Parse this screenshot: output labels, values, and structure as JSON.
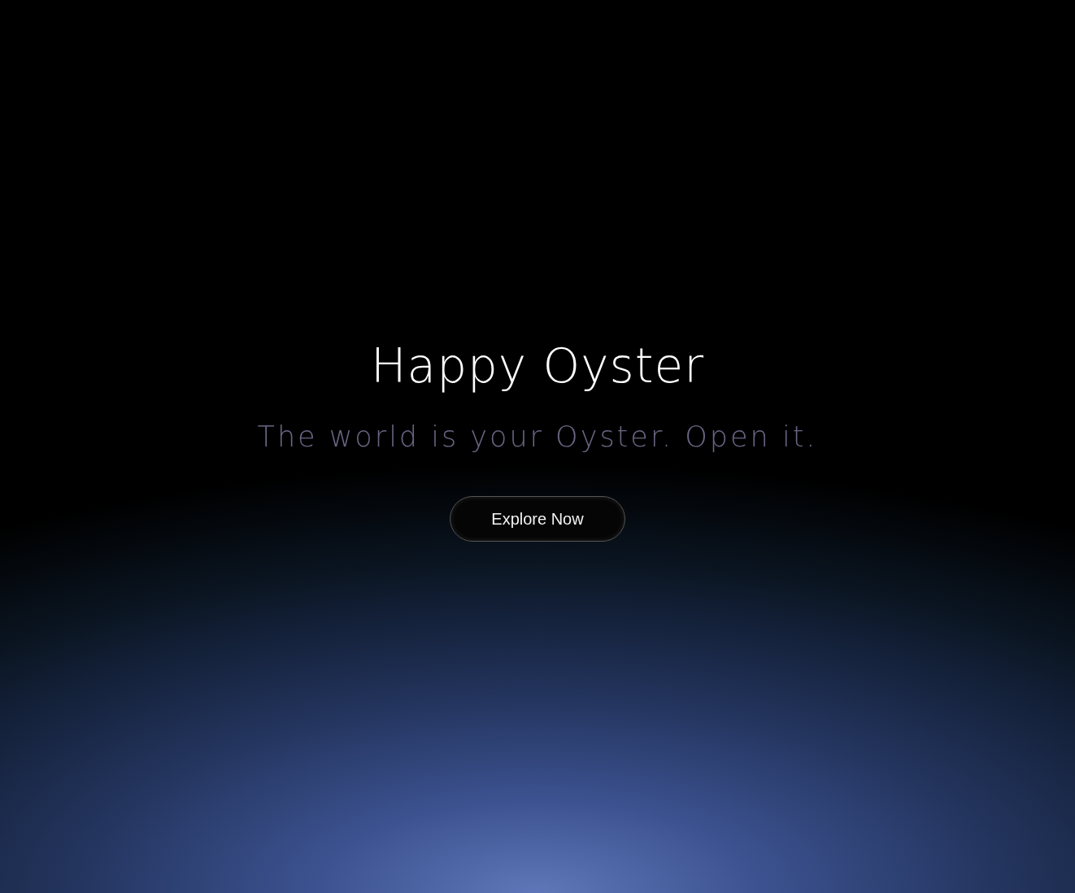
{
  "hero": {
    "title": "Happy Oyster",
    "tagline": "The world is your Oyster. Open it.",
    "button": "Explore Now"
  }
}
